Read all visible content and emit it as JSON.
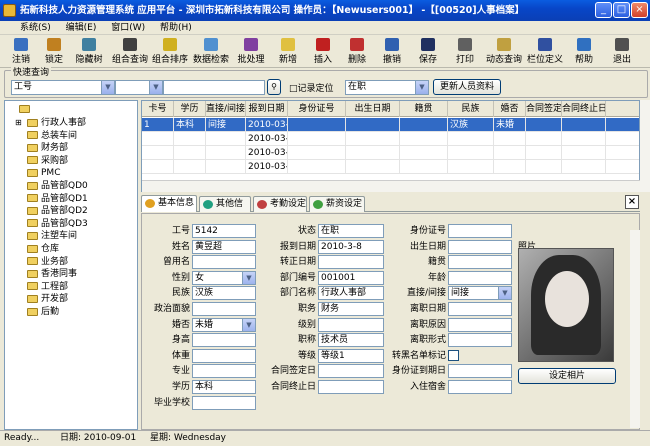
{
  "window": {
    "title": "拓新科技人力资源管理系统 应用平台  -  深圳市拓新科技有限公司      操作员：【Newusers001】 -【[00520]人事档案】",
    "buttons": [
      "_",
      "□",
      "×"
    ]
  },
  "menu": [
    "系统(S)",
    "编辑(E)",
    "窗口(W)",
    "帮助(H)"
  ],
  "toolbar": [
    {
      "label": "注销",
      "icon": "logout-icon",
      "color": "#3a70c0"
    },
    {
      "label": "锁定",
      "icon": "lock-icon",
      "color": "#c08020"
    },
    {
      "label": "隐藏树",
      "icon": "tree-icon",
      "color": "#4080a0"
    },
    {
      "label": "组合查询",
      "icon": "binoculars-icon",
      "color": "#404040"
    },
    {
      "label": "组合排序",
      "icon": "sort-icon",
      "color": "#d0b020"
    },
    {
      "label": "数据检索",
      "icon": "search-data-icon",
      "color": "#5090d0"
    },
    {
      "label": "批处理",
      "icon": "batch-icon",
      "color": "#8040a0"
    },
    {
      "label": "新增",
      "icon": "new-icon",
      "color": "#e0c040"
    },
    {
      "label": "插入",
      "icon": "insert-icon",
      "color": "#c02020"
    },
    {
      "label": "删除",
      "icon": "delete-icon",
      "color": "#c03030"
    },
    {
      "label": "撤销",
      "icon": "undo-icon",
      "color": "#3060b0"
    },
    {
      "label": "保存",
      "icon": "save-icon",
      "color": "#203060"
    },
    {
      "label": "打印",
      "icon": "print-icon",
      "color": "#606060"
    },
    {
      "label": "动态查询",
      "icon": "dynamic-query-icon",
      "color": "#c0a040"
    },
    {
      "label": "栏位定义",
      "icon": "column-icon",
      "color": "#3050a0"
    },
    {
      "label": "帮助",
      "icon": "help-icon",
      "color": "#3070c0"
    },
    {
      "label": "退出",
      "icon": "exit-icon",
      "color": "#505050"
    }
  ],
  "quick": {
    "legend": "快速查询",
    "field": "工号",
    "operator": "",
    "value": "",
    "record_pos": "□记录定位",
    "status": "在职",
    "refresh": "更新人员资料"
  },
  "tree": [
    "行政人事部",
    "总装车间",
    "财务部",
    "采购部",
    "PMC",
    "品管部QD0",
    "品管部QD1",
    "品管部QD2",
    "品管部QD3",
    "注塑车间",
    "仓库",
    "业务部",
    "香港同事",
    "工程部",
    "开发部",
    "后勤"
  ],
  "grid": {
    "columns": [
      "卡号",
      "学历",
      "直接/间接",
      "报到日期",
      "身份证号",
      "出生日期",
      "籍贯",
      "民族",
      "婚否",
      "合同签定日",
      "合同终止日"
    ],
    "rows": [
      [
        "1",
        "本科",
        "间接",
        "2010-03-08",
        "",
        "",
        "",
        "汉族",
        "未婚",
        "",
        ""
      ],
      [
        "",
        "",
        "",
        "2010-03-08",
        "",
        "",
        "",
        "",
        "",
        "",
        ""
      ],
      [
        "",
        "",
        "",
        "2010-03-15",
        "",
        "",
        "",
        "",
        "",
        "",
        ""
      ],
      [
        "",
        "",
        "",
        "2010-03-09",
        "",
        "",
        "",
        "",
        "",
        "",
        ""
      ]
    ]
  },
  "tabs": [
    "基本信息",
    "其他信息",
    "考勤设定",
    "薪资设定"
  ],
  "form": {
    "col1": [
      {
        "l": "工号",
        "v": "5142"
      },
      {
        "l": "姓名",
        "v": "黄昱超"
      },
      {
        "l": "曾用名",
        "v": ""
      },
      {
        "l": "性别",
        "v": "女"
      },
      {
        "l": "民族",
        "v": "汉族"
      },
      {
        "l": "政治面貌",
        "v": ""
      },
      {
        "l": "婚否",
        "v": "未婚"
      },
      {
        "l": "身高",
        "v": ""
      },
      {
        "l": "体重",
        "v": ""
      },
      {
        "l": "专业",
        "v": ""
      },
      {
        "l": "学历",
        "v": "本科"
      },
      {
        "l": "毕业学校",
        "v": ""
      }
    ],
    "col2": [
      {
        "l": "状态",
        "v": "在职"
      },
      {
        "l": "报到日期",
        "v": "2010-3-8"
      },
      {
        "l": "转正日期",
        "v": ""
      },
      {
        "l": "部门编号",
        "v": "001001"
      },
      {
        "l": "部门名称",
        "v": "行政人事部"
      },
      {
        "l": "职务",
        "v": "财务"
      },
      {
        "l": "级别",
        "v": ""
      },
      {
        "l": "职称",
        "v": "技术员"
      },
      {
        "l": "等级",
        "v": "等级1"
      },
      {
        "l": "合同签定日",
        "v": ""
      },
      {
        "l": "合同终止日",
        "v": ""
      }
    ],
    "col3": [
      {
        "l": "身份证号",
        "v": ""
      },
      {
        "l": "出生日期",
        "v": ""
      },
      {
        "l": "籍贯",
        "v": ""
      },
      {
        "l": "年龄",
        "v": ""
      },
      {
        "l": "直接/间接",
        "v": "间接"
      },
      {
        "l": "离职日期",
        "v": ""
      },
      {
        "l": "离职原因",
        "v": ""
      },
      {
        "l": "离职形式",
        "v": ""
      },
      {
        "l": "转黑名单标记",
        "v": ""
      },
      {
        "l": "身份证到期日",
        "v": ""
      },
      {
        "l": "入住宿舍",
        "v": ""
      }
    ],
    "photo_label": "照片",
    "set_photo": "设定相片"
  },
  "status": {
    "ready": "Ready...",
    "date": "日期: 2010-09-01",
    "week": "星期: Wednesday"
  }
}
